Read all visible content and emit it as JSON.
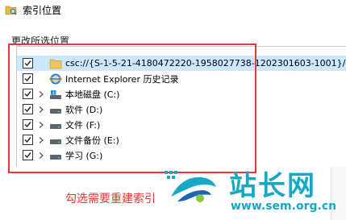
{
  "window": {
    "title": "索引位置",
    "icon": "folder-search-icon"
  },
  "group": {
    "label": "更改所选位置"
  },
  "tree": {
    "items": [
      {
        "label": "csc://{S-1-5-21-4180472220-1958027738-1202301603-1001}/",
        "checked": true,
        "expandable": false,
        "icon": "folder-icon",
        "selected": true
      },
      {
        "label": "Internet Explorer 历史记录",
        "checked": true,
        "expandable": false,
        "icon": "internet-explorer-icon",
        "selected": false
      },
      {
        "label": "本地磁盘 (C:)",
        "checked": true,
        "expandable": true,
        "icon": "system-drive-icon",
        "selected": false
      },
      {
        "label": "软件 (D:)",
        "checked": true,
        "expandable": true,
        "icon": "drive-icon",
        "selected": false
      },
      {
        "label": "文件 (F:)",
        "checked": true,
        "expandable": true,
        "icon": "drive-icon",
        "selected": false
      },
      {
        "label": "文件备份 (E:)",
        "checked": true,
        "expandable": true,
        "icon": "drive-icon",
        "selected": false
      },
      {
        "label": "学习 (G:)",
        "checked": true,
        "expandable": true,
        "icon": "drive-icon",
        "selected": false
      }
    ]
  },
  "annotation": {
    "text": "勾选需要重建索引"
  },
  "watermark": {
    "title": "站长网",
    "url": "www.sem.org.cn"
  },
  "colors": {
    "highlight": "#e53935",
    "selection": "#cce8ff",
    "watermark": "#16a8c4"
  }
}
